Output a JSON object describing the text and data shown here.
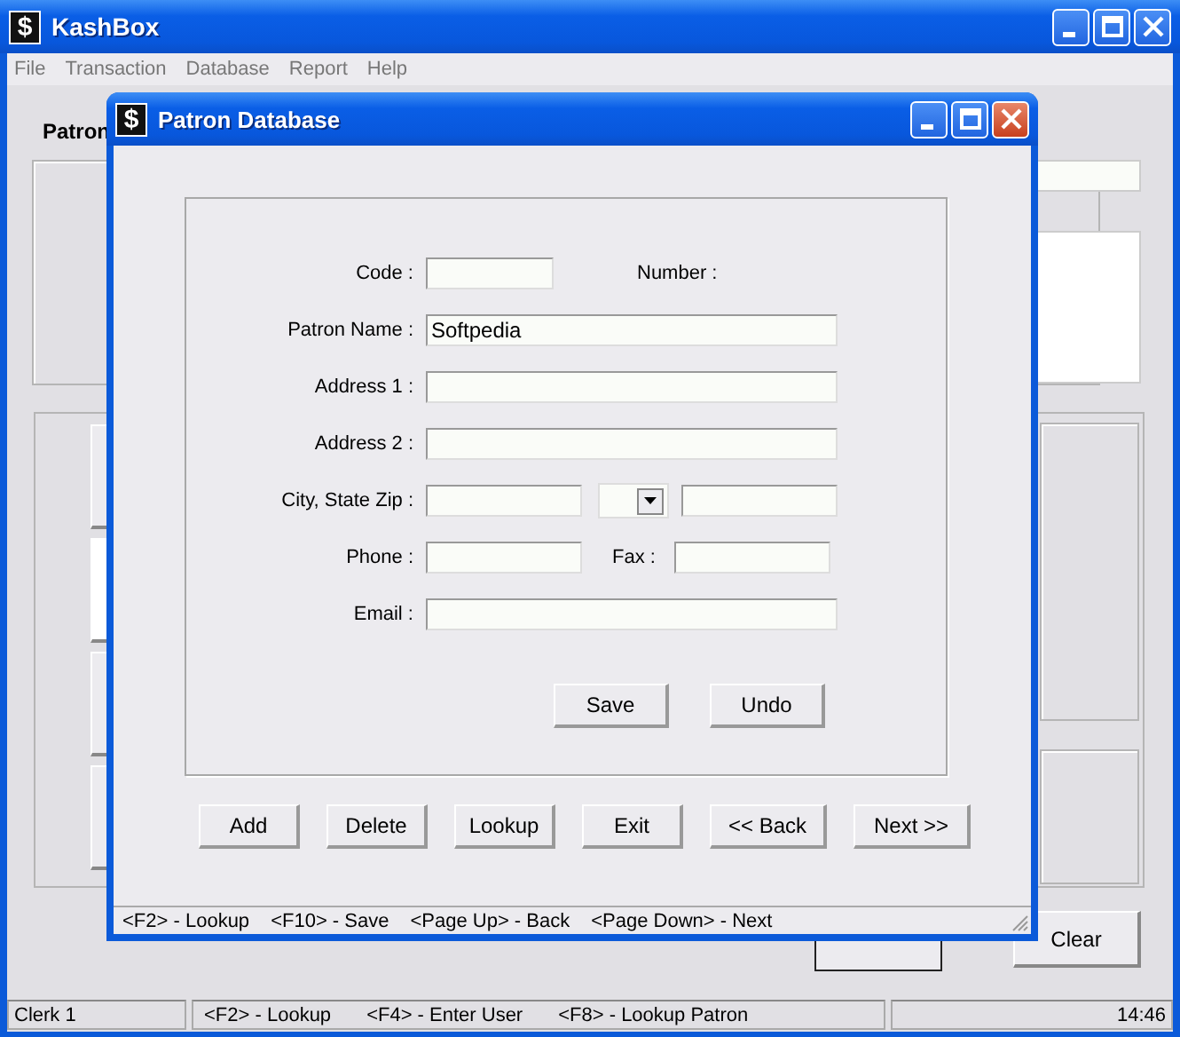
{
  "window": {
    "app_icon": "$",
    "title": "KashBox"
  },
  "menu": [
    "File",
    "Transaction",
    "Database",
    "Report",
    "Help"
  ],
  "main": {
    "patron_label": "Patron",
    "clear_button": "Clear"
  },
  "status_bar": {
    "clerk": "Clerk 1",
    "hints": [
      "<F2> - Lookup",
      "<F4> - Enter User",
      "<F8> - Lookup Patron"
    ],
    "time": "14:46"
  },
  "dialog": {
    "app_icon": "$",
    "title": "Patron Database",
    "rows": [
      {
        "label": "Patron Name :",
        "items": [
          {
            "kind": "input",
            "value": "Softpedia"
          }
        ]
      },
      {
        "label": "Address 1 :",
        "items": [
          {
            "kind": "input"
          }
        ]
      },
      {
        "label": "Address 2 :",
        "items": [
          {
            "kind": "input"
          }
        ]
      },
      {
        "label": "City, State Zip :",
        "items": [
          {
            "kind": "input"
          },
          {
            "kind": "combo"
          },
          {
            "kind": "input"
          }
        ]
      },
      {
        "label": "Phone :",
        "items": [
          {
            "kind": "input"
          },
          {
            "kind": "label",
            "text": "Fax :"
          },
          {
            "kind": "input"
          }
        ]
      },
      {
        "label": "Email :",
        "items": [
          {
            "kind": "input"
          }
        ]
      }
    ],
    "code_row": {
      "label": "Code :",
      "second_label": "Number :"
    },
    "form_buttons": [
      "Save",
      "Undo"
    ],
    "nav_buttons": [
      "Add",
      "Delete",
      "Lookup",
      "Exit",
      "<< Back",
      "Next >>"
    ],
    "status_bar": [
      "<F2> - Lookup",
      "<F10> - Save",
      "<Page Up> - Back",
      "<Page Down> - Next"
    ]
  }
}
